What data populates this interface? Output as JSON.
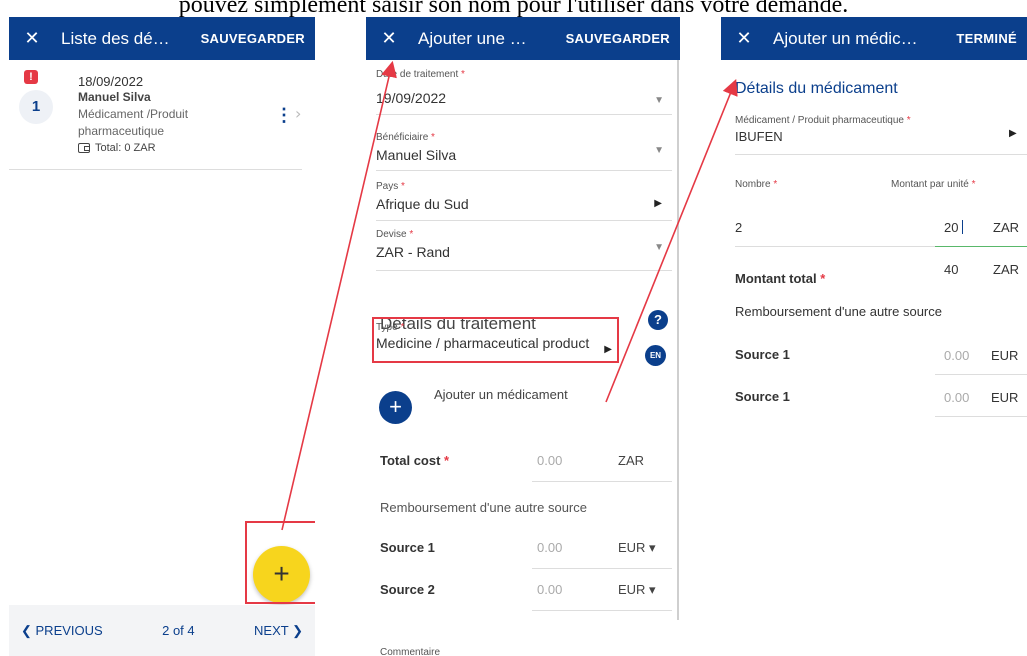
{
  "caption": "pouvez simplement saisir son nom pour l'utiliser dans votre demande.",
  "panel1": {
    "title": "Liste des dé…",
    "action": "SAUVEGARDER",
    "item": {
      "alert": "!",
      "number": "1",
      "date": "18/09/2022",
      "name": "Manuel Silva",
      "type_line1": "Médicament /Produit",
      "type_line2": "pharmaceutique",
      "total": "Total: 0 ZAR"
    },
    "fab": "+",
    "footer": {
      "prev": "❮ PREVIOUS",
      "page": "2 of 4",
      "next": "NEXT ❯"
    }
  },
  "panel2": {
    "title": "Ajouter une …",
    "action": "SAUVEGARDER",
    "fields": [
      {
        "label": "Date de traitement",
        "value": "19/09/2022"
      },
      {
        "label": "Bénéficiaire",
        "value": "Manuel Silva"
      },
      {
        "label": "Pays",
        "value": "Afrique du Sud"
      },
      {
        "label": "Devise",
        "value": "ZAR - Rand"
      }
    ],
    "section_title": "Détails du traitement",
    "help": "?",
    "type": {
      "label": "Type",
      "value": "Medicine / pharmaceutical product"
    },
    "lang": "EN",
    "add_medicine": "Ajouter un médicament",
    "total_cost": {
      "label": "Total cost",
      "amount": "0.00",
      "currency": "ZAR"
    },
    "reimbursement_title": "Remboursement d'une autre source",
    "sources": [
      {
        "label": "Source 1",
        "amount": "0.00",
        "currency": "EUR ▾"
      },
      {
        "label": "Source 2",
        "amount": "0.00",
        "currency": "EUR ▾"
      }
    ],
    "comment": "Commentaire"
  },
  "panel3": {
    "title": "Ajouter un médic…",
    "action": "TERMINÉ",
    "section_title": "Détails du médicament",
    "medicine": {
      "label": "Médicament / Produit pharmaceutique",
      "value": "IBUFEN"
    },
    "quantity": {
      "label": "Nombre",
      "value": "2"
    },
    "unit_amount": {
      "label": "Montant par unité",
      "value": "20",
      "currency": "ZAR"
    },
    "total_amount": {
      "label": "Montant total",
      "value": "40",
      "currency": "ZAR"
    },
    "reimbursement_title": "Remboursement d'une autre source",
    "sources": [
      {
        "label": "Source 1",
        "amount": "0.00",
        "currency": "EUR"
      },
      {
        "label": "Source 1",
        "amount": "0.00",
        "currency": "EUR"
      }
    ]
  },
  "colors": {
    "header": "#0b3f8c",
    "fab": "#f7d51d",
    "highlight": "#e53945",
    "accent_line": "#59b86a"
  }
}
